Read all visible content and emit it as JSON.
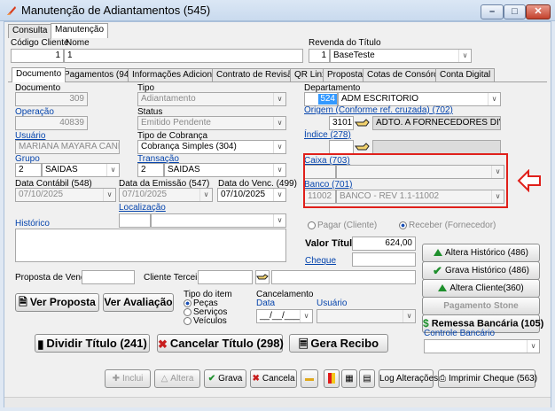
{
  "window": {
    "title": "Manutenção de Adiantamentos (545)",
    "min": "–",
    "max": "□",
    "close": "✕"
  },
  "top_tabs": [
    "Consulta",
    "Manutenção"
  ],
  "header": {
    "codigo_cliente_label": "Código Cliente",
    "codigo_cliente": "1",
    "nome_label": "Nome",
    "nome": "1",
    "revenda_label": "Revenda do Título",
    "revenda_cod": "1",
    "revenda_nome": "BaseTeste"
  },
  "tabs": [
    "Documento",
    "Pagamentos (943)",
    "Informações Adicionais",
    "Contrato de Revisão",
    "QR Linx",
    "Proposta",
    "Cotas de Consórcio",
    "Conta Digital"
  ],
  "form": {
    "documento_label": "Documento",
    "documento": "309",
    "tipo_label": "Tipo",
    "tipo": "Adiantamento",
    "operacao_label": "Operação",
    "operacao": "40839",
    "status_label": "Status",
    "status": "Emitido Pendente",
    "usuario_label": "Usuário",
    "usuario": "MARIANA MAYARA CANDIDO",
    "tipo_cobranca_label": "Tipo de Cobrança",
    "tipo_cobranca": "Cobrança Simples (304)",
    "grupo_label": "Grupo",
    "grupo_cod": "2",
    "grupo_nome": "SAIDAS",
    "transacao_label": "Transação",
    "transacao_cod": "2",
    "transacao_nome": "SAIDAS",
    "data_contabil_label": "Data Contábil (548)",
    "data_contabil": "07/10/2025",
    "data_emissao_label": "Data da Emissão (547)",
    "data_emissao": "07/10/2025",
    "data_venc_label": "Data do Venc. (499)",
    "data_venc": "07/10/2025",
    "localizacao_label": "Localização",
    "historico_label": "Histórico",
    "departamento_label": "Departamento",
    "departamento_cod": "524",
    "departamento_nome": "ADM ESCRITORIO",
    "origem_label": "Origem (Conforme ref. cruzada) (702)",
    "origem_cod": "3101",
    "origem_nome": "ADTO. A FORNECEDORES DIVERSOS",
    "indice_label": "Índice (278)",
    "caixa_label": "Caixa (703)",
    "banco_label": "Banco (701)",
    "banco_cod": "11002",
    "banco_nome": "BANCO - REV 1.1-11002",
    "pagar_label": "Pagar (Cliente)",
    "receber_label": "Receber (Fornecedor)",
    "valor_titulo_label": "Valor Título",
    "valor_titulo": "624,00",
    "cheque_label": "Cheque",
    "proposta_venda_label": "Proposta de Venda",
    "cliente_terceiro_label": "Cliente Terceiro",
    "tipo_item_label": "Tipo do item",
    "tipo_item_options": [
      "Peças",
      "Serviços",
      "Veículos"
    ],
    "cancelamento_label": "Cancelamento",
    "cancel_data_label": "Data",
    "cancel_data": "__/__/____",
    "cancel_usuario_label": "Usuário",
    "controle_bancario_label": "Controle Bancário"
  },
  "buttons": {
    "altera_historico": "Altera Histórico (486)",
    "grava_historico": "Grava Histórico  (486)",
    "altera_cliente": "Altera Cliente(360)",
    "pagamento_stone": "Pagamento Stone",
    "remessa_bancaria": "Remessa Bancária (105)",
    "ver_proposta": "Ver Proposta",
    "ver_avaliacao": "Ver Avaliação",
    "dividir_titulo": "Dividir Título (241)",
    "cancelar_titulo": "Cancelar Título (298)",
    "gera_recibo": "Gera Recibo",
    "inclui": "Inclui",
    "altera": "Altera",
    "grava": "Grava",
    "cancela": "Cancela",
    "log_alteracoes": "Log Alterações",
    "imprimir_cheque": "Imprimir Cheque (563)"
  },
  "colors": {
    "highlight": "#e0201b",
    "link": "#0645ad",
    "selection": "#3399ff"
  }
}
